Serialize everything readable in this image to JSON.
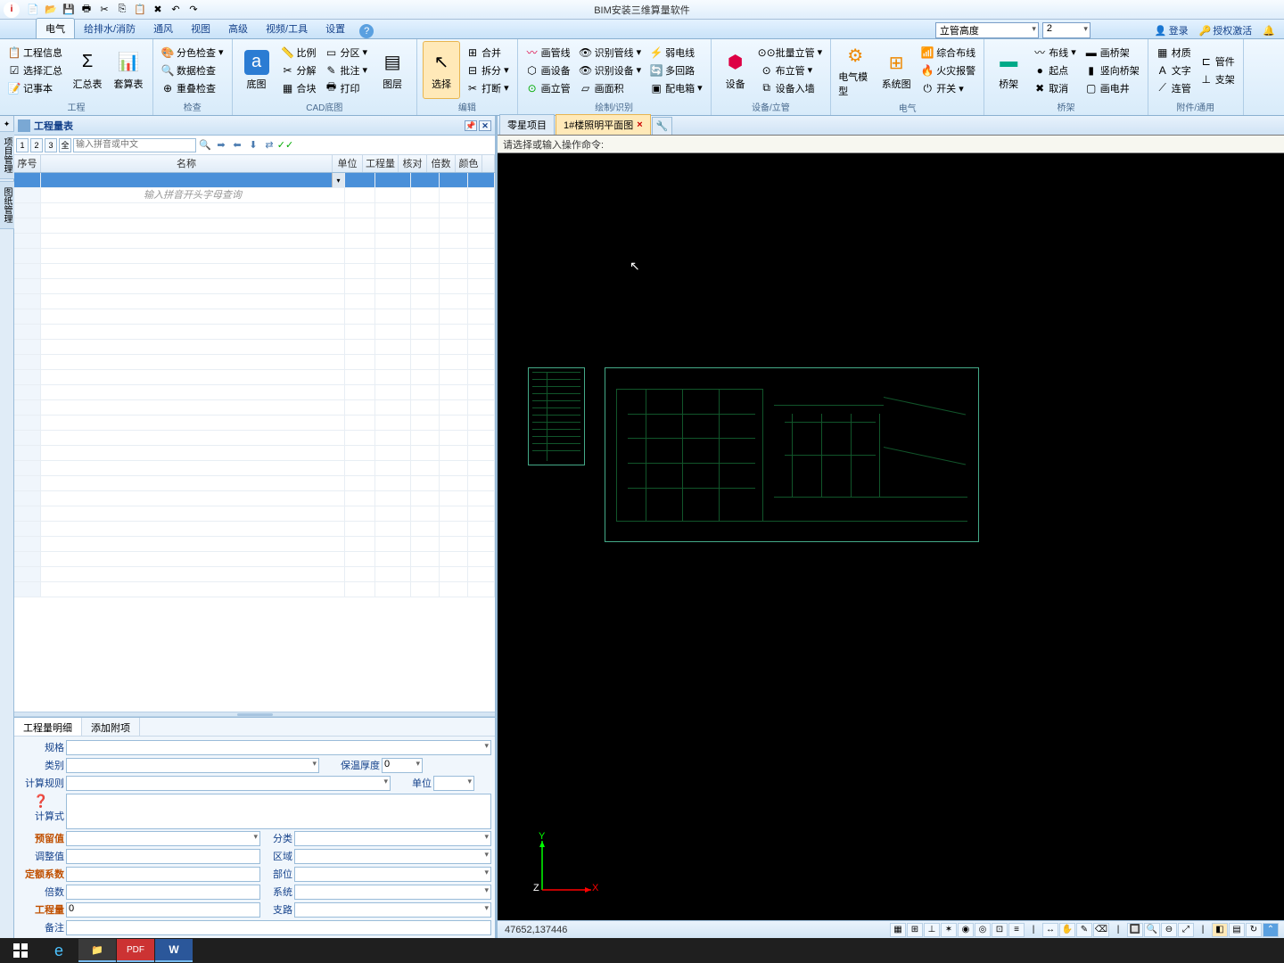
{
  "app": {
    "title": "BIM安装三维算量软件"
  },
  "qat_icons": [
    "new",
    "open",
    "save",
    "print",
    "cut",
    "copy",
    "paste",
    "delete",
    "undo",
    "redo"
  ],
  "ribbon": {
    "combo1": "立管高度",
    "combo2": "2",
    "login": "登录",
    "auth": "授权激活",
    "tabs": [
      "电气",
      "给排水/消防",
      "通风",
      "视图",
      "高级",
      "视频/工具",
      "设置"
    ],
    "groups": {
      "g1": {
        "label": "工程",
        "btns": [
          "工程信息",
          "选择汇总",
          "记事本"
        ],
        "big": [
          "汇总表",
          "套算表"
        ]
      },
      "g2": {
        "label": "检查",
        "btns": [
          "分色检查",
          "数据检查",
          "重叠检查"
        ]
      },
      "g3": {
        "label": "CAD底图",
        "big": "底图",
        "btns": [
          "比例",
          "分解",
          "合块",
          "分区",
          "批注",
          "打印",
          "图层"
        ]
      },
      "g4": {
        "label": "编辑",
        "big": "选择",
        "btns": [
          "合并",
          "拆分",
          "打断"
        ]
      },
      "g5": {
        "label": "绘制/识别",
        "btns1": [
          "画管线",
          "画设备",
          "画立管"
        ],
        "btns2": [
          "识别管线",
          "识别设备",
          "画面积"
        ],
        "btns3": [
          "弱电线",
          "多回路",
          "配电箱"
        ]
      },
      "g6": {
        "label": "设备/立管",
        "big": "设备",
        "btns": [
          "批量立管",
          "布立管",
          "设备入墙"
        ]
      },
      "g7": {
        "label": "电气",
        "big": [
          "电气模型",
          "系统图"
        ],
        "btns": [
          "综合布线",
          "火灾报警",
          "开关"
        ]
      },
      "g8": {
        "label": "桥架",
        "big": "桥架",
        "btns": [
          "布线",
          "起点",
          "取消",
          "画桥架",
          "竖向桥架",
          "画电井"
        ]
      },
      "g9": {
        "label": "附件/通用",
        "btns": [
          "材质",
          "文字",
          "连管",
          "管件",
          "支架"
        ]
      }
    }
  },
  "panel": {
    "title": "工程量表",
    "pages": [
      "1",
      "2",
      "3",
      "全"
    ],
    "search_ph": "输入拼音或中文",
    "headers": {
      "seq": "序号",
      "name": "名称",
      "unit": "单位",
      "qty": "工程量",
      "chk": "核对",
      "mul": "倍数",
      "col": "颜色"
    },
    "hint": "输入拼音开头字母查询",
    "detail_tabs": [
      "工程量明细",
      "添加附项"
    ],
    "form": {
      "spec": "规格",
      "type": "类别",
      "rule": "计算规则",
      "ins": "保温厚度",
      "ins_v": "0",
      "unit": "单位",
      "formula": "计算式",
      "reserve": "预留值",
      "classify": "分类",
      "adjust": "调整值",
      "area": "区域",
      "quota": "定额系数",
      "part": "部位",
      "mul": "倍数",
      "sys": "系统",
      "qty": "工程量",
      "qty_v": "0",
      "branch": "支路",
      "remark": "备注"
    }
  },
  "side_tabs": [
    "项目管理",
    "图纸管理"
  ],
  "docs": {
    "tab1": "零星项目",
    "tab2": "1#楼照明平面图"
  },
  "cmd": "请选择或输入操作命令:",
  "status": {
    "coord": "47652,137446"
  },
  "ucs": {
    "x": "X",
    "y": "Y",
    "z": "Z"
  }
}
